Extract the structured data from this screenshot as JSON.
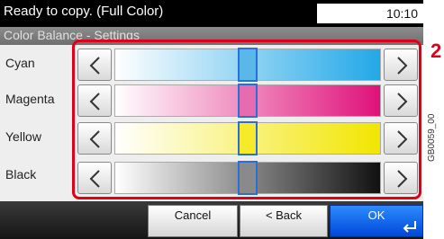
{
  "status": {
    "message": "Ready to copy. (Full Color)",
    "time": "10:10"
  },
  "title": "Color Balance - Settings",
  "rows": [
    {
      "label": "Cyan"
    },
    {
      "label": "Magenta"
    },
    {
      "label": "Yellow"
    },
    {
      "label": "Black"
    }
  ],
  "colors": {
    "cyan_end": "#22a8e8",
    "magenta_end": "#e0117a",
    "yellow_end": "#f2e600",
    "black_end": "#111111",
    "highlight_red": "#e0001a",
    "ok_blue": "#1e6cf0"
  },
  "footer": {
    "cancel": "Cancel",
    "back": "< Back",
    "ok": "OK"
  },
  "step_number": "2",
  "doc_code": "GB0059_00",
  "icons": [
    "left-arrow-icon",
    "right-arrow-icon",
    "enter-icon"
  ]
}
